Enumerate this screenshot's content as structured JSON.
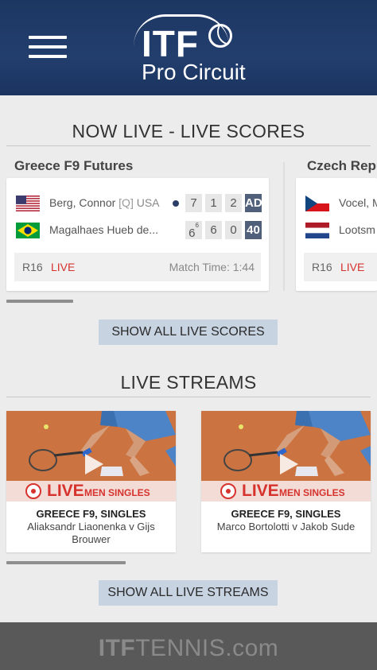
{
  "header": {
    "logo_itf": "ITF",
    "logo_subtitle": "Pro Circuit"
  },
  "live_scores": {
    "section_title": "NOW LIVE - LIVE SCORES",
    "matches": [
      {
        "tournament": "Greece F9 Futures",
        "players": [
          {
            "name": "Berg, Connor",
            "qualifier": "[Q]",
            "nationality": "USA",
            "serving": true,
            "sets": [
              "7",
              "1",
              "2"
            ],
            "game": "AD",
            "flag": "us-flag-icon"
          },
          {
            "name": "Magalhaes Hueb de...",
            "qualifier": "",
            "nationality": "",
            "serving": false,
            "sets": [
              "6",
              "6",
              "0"
            ],
            "set_tiebreaks": [
              "6",
              "",
              ""
            ],
            "game": "40",
            "flag": "brazil-flag-icon"
          }
        ],
        "round": "R16",
        "status": "LIVE",
        "match_time": "Match Time: 1:44"
      },
      {
        "tournament": "Czech Repu",
        "players": [
          {
            "name": "Vocel, M",
            "flag": "czech-flag-icon"
          },
          {
            "name": "Lootsm",
            "flag": "netherlands-flag-icon"
          }
        ],
        "round": "R16",
        "status": "LIVE"
      }
    ],
    "button_label": "SHOW ALL LIVE SCORES"
  },
  "live_streams": {
    "section_title": "LIVE STREAMS",
    "streams": [
      {
        "live_label": "LIVE",
        "category": "MEN SINGLES",
        "title": "GREECE F9, SINGLES",
        "players": "Aliaksandr Liaonenka v Gijs Brouwer"
      },
      {
        "live_label": "LIVE",
        "category": "MEN SINGLES",
        "title": "GREECE F9, SINGLES",
        "players": "Marco Bortolotti v Jakob Sude"
      }
    ],
    "button_label": "SHOW ALL LIVE STREAMS"
  },
  "footer": {
    "logo_itf": "ITF",
    "logo_rest": "TENNIS.com"
  },
  "colors": {
    "header_bg": "#1d3763",
    "live_red": "#d6322e",
    "button_bg": "#c8d3e2",
    "game_box": "#50607b"
  }
}
